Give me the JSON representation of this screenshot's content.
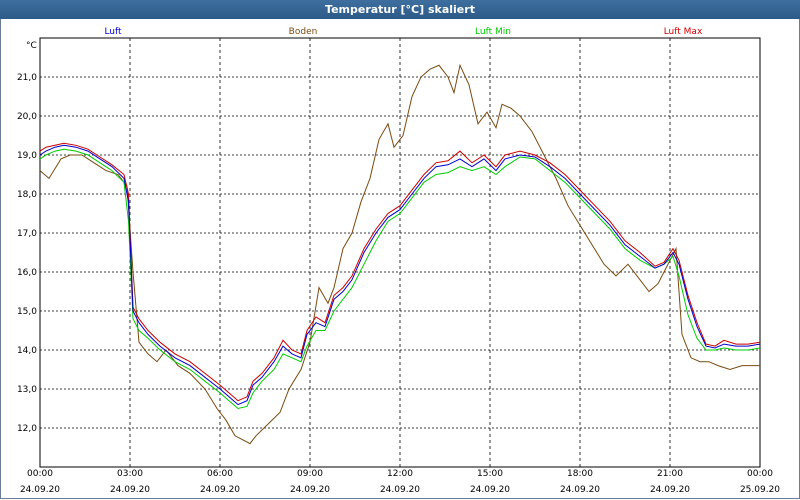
{
  "window": {
    "title": "Temperatur [°C] skaliert"
  },
  "chart_data": {
    "type": "line",
    "ylabel": "°C",
    "ylim": [
      11.0,
      22.0
    ],
    "yticks": [
      "12,0",
      "13,0",
      "14,0",
      "15,0",
      "16,0",
      "17,0",
      "18,0",
      "19,0",
      "20,0",
      "21,0"
    ],
    "xrange_hours": [
      0,
      24
    ],
    "xticks": [
      {
        "time": "00:00",
        "date": "24.09.20"
      },
      {
        "time": "03:00",
        "date": "24.09.20"
      },
      {
        "time": "06:00",
        "date": "24.09.20"
      },
      {
        "time": "09:00",
        "date": "24.09.20"
      },
      {
        "time": "12:00",
        "date": "24.09.20"
      },
      {
        "time": "15:00",
        "date": "24.09.20"
      },
      {
        "time": "18:00",
        "date": "24.09.20"
      },
      {
        "time": "21:00",
        "date": "24.09.20"
      },
      {
        "time": "00:00",
        "date": "25.09.20"
      }
    ],
    "grid": true,
    "legend_position": "top",
    "series": [
      {
        "name": "Luft",
        "color": "#0000cc",
        "x": [
          0,
          0.2,
          0.5,
          0.8,
          1.2,
          1.6,
          2.0,
          2.4,
          2.8,
          2.95,
          3.1,
          3.3,
          3.6,
          4.0,
          4.5,
          5.0,
          5.5,
          6.0,
          6.3,
          6.6,
          6.9,
          7.1,
          7.4,
          7.8,
          8.1,
          8.4,
          8.7,
          8.9,
          9.2,
          9.5,
          9.8,
          10.1,
          10.4,
          10.8,
          11.2,
          11.6,
          12.0,
          12.4,
          12.8,
          13.2,
          13.6,
          14.0,
          14.4,
          14.8,
          15.2,
          15.5,
          16.0,
          16.5,
          17.0,
          17.5,
          18.0,
          18.5,
          19.0,
          19.5,
          20.0,
          20.5,
          20.8,
          21.1,
          21.3,
          21.6,
          21.9,
          22.2,
          22.5,
          22.8,
          23.2,
          23.6,
          24.0
        ],
        "values": [
          19.0,
          19.1,
          19.2,
          19.25,
          19.2,
          19.1,
          18.9,
          18.7,
          18.4,
          17.8,
          15.0,
          14.7,
          14.4,
          14.1,
          13.8,
          13.6,
          13.3,
          13.0,
          12.8,
          12.6,
          12.7,
          13.1,
          13.3,
          13.7,
          14.1,
          13.9,
          13.8,
          14.4,
          14.7,
          14.6,
          15.3,
          15.5,
          15.8,
          16.5,
          17.0,
          17.4,
          17.6,
          18.0,
          18.4,
          18.7,
          18.75,
          18.9,
          18.7,
          18.9,
          18.6,
          18.9,
          19.0,
          18.95,
          18.7,
          18.4,
          18.0,
          17.6,
          17.2,
          16.7,
          16.4,
          16.1,
          16.2,
          16.5,
          16.2,
          15.3,
          14.6,
          14.1,
          14.05,
          14.15,
          14.1,
          14.1,
          14.15
        ]
      },
      {
        "name": "Boden",
        "color": "#7a4a10",
        "x": [
          0,
          0.3,
          0.7,
          1.0,
          1.4,
          1.8,
          2.2,
          2.6,
          2.9,
          3.1,
          3.3,
          3.6,
          3.9,
          4.2,
          4.6,
          5.0,
          5.5,
          5.9,
          6.2,
          6.5,
          7.0,
          7.2,
          7.6,
          8.0,
          8.3,
          8.7,
          9.0,
          9.3,
          9.6,
          9.8,
          10.1,
          10.4,
          10.7,
          11.0,
          11.3,
          11.6,
          11.8,
          12.1,
          12.4,
          12.7,
          13.0,
          13.3,
          13.6,
          13.8,
          14.0,
          14.3,
          14.6,
          14.9,
          15.2,
          15.4,
          15.7,
          16.0,
          16.4,
          16.8,
          17.2,
          17.6,
          18.0,
          18.4,
          18.8,
          19.2,
          19.6,
          20.0,
          20.3,
          20.6,
          20.8,
          21.0,
          21.2,
          21.4,
          21.7,
          22.0,
          22.3,
          22.6,
          23.0,
          23.4,
          23.8,
          24.0
        ],
        "values": [
          18.6,
          18.4,
          18.9,
          19.0,
          19.0,
          18.8,
          18.6,
          18.5,
          18.2,
          16.0,
          14.2,
          13.9,
          13.7,
          14.0,
          13.6,
          13.4,
          13.0,
          12.5,
          12.2,
          11.8,
          11.6,
          11.8,
          12.1,
          12.4,
          13.0,
          13.5,
          14.2,
          15.6,
          15.2,
          15.6,
          16.6,
          17.0,
          17.8,
          18.4,
          19.4,
          19.8,
          19.2,
          19.5,
          20.5,
          21.0,
          21.2,
          21.3,
          21.0,
          20.6,
          21.3,
          20.8,
          19.8,
          20.1,
          19.7,
          20.3,
          20.2,
          20.0,
          19.6,
          19.0,
          18.4,
          17.7,
          17.2,
          16.7,
          16.2,
          15.9,
          16.2,
          15.8,
          15.5,
          15.7,
          16.0,
          16.3,
          16.6,
          14.4,
          13.8,
          13.7,
          13.7,
          13.6,
          13.5,
          13.6,
          13.6,
          13.6
        ]
      },
      {
        "name": "Luft Min",
        "color": "#00cc00",
        "x": [
          0,
          0.2,
          0.5,
          0.8,
          1.2,
          1.6,
          2.0,
          2.4,
          2.8,
          2.95,
          3.1,
          3.3,
          3.6,
          4.0,
          4.5,
          5.0,
          5.5,
          6.0,
          6.3,
          6.6,
          6.9,
          7.1,
          7.4,
          7.8,
          8.1,
          8.4,
          8.7,
          8.9,
          9.2,
          9.5,
          9.8,
          10.1,
          10.4,
          10.8,
          11.2,
          11.6,
          12.0,
          12.4,
          12.8,
          13.2,
          13.6,
          14.0,
          14.4,
          14.8,
          15.2,
          15.5,
          16.0,
          16.5,
          17.0,
          17.5,
          18.0,
          18.5,
          19.0,
          19.5,
          20.0,
          20.5,
          20.8,
          21.1,
          21.3,
          21.6,
          21.9,
          22.2,
          22.5,
          22.8,
          23.2,
          23.6,
          24.0
        ],
        "values": [
          18.9,
          19.0,
          19.1,
          19.15,
          19.1,
          19.0,
          18.8,
          18.6,
          18.3,
          17.3,
          14.8,
          14.5,
          14.3,
          14.0,
          13.7,
          13.5,
          13.2,
          12.9,
          12.7,
          12.5,
          12.55,
          12.9,
          13.2,
          13.5,
          13.9,
          13.8,
          13.7,
          14.1,
          14.5,
          14.5,
          15.0,
          15.3,
          15.6,
          16.2,
          16.8,
          17.3,
          17.5,
          17.9,
          18.3,
          18.5,
          18.55,
          18.7,
          18.6,
          18.7,
          18.5,
          18.7,
          18.95,
          18.9,
          18.6,
          18.3,
          17.9,
          17.5,
          17.1,
          16.6,
          16.3,
          16.1,
          16.2,
          16.4,
          15.9,
          14.9,
          14.3,
          14.0,
          14.0,
          14.05,
          14.0,
          14.0,
          14.05
        ]
      },
      {
        "name": "Luft Max",
        "color": "#cc0000",
        "x": [
          0,
          0.2,
          0.5,
          0.8,
          1.2,
          1.6,
          2.0,
          2.4,
          2.8,
          2.95,
          3.1,
          3.3,
          3.6,
          4.0,
          4.5,
          5.0,
          5.5,
          6.0,
          6.3,
          6.6,
          6.9,
          7.1,
          7.4,
          7.8,
          8.1,
          8.4,
          8.7,
          8.9,
          9.2,
          9.5,
          9.8,
          10.1,
          10.4,
          10.8,
          11.2,
          11.6,
          12.0,
          12.4,
          12.8,
          13.2,
          13.6,
          14.0,
          14.4,
          14.8,
          15.2,
          15.5,
          16.0,
          16.5,
          17.0,
          17.5,
          18.0,
          18.5,
          19.0,
          19.5,
          20.0,
          20.5,
          20.8,
          21.1,
          21.3,
          21.6,
          21.9,
          22.2,
          22.5,
          22.8,
          23.2,
          23.6,
          24.0
        ],
        "values": [
          19.1,
          19.2,
          19.25,
          19.3,
          19.25,
          19.15,
          18.95,
          18.75,
          18.5,
          18.0,
          15.1,
          14.8,
          14.5,
          14.2,
          13.9,
          13.7,
          13.4,
          13.1,
          12.9,
          12.7,
          12.8,
          13.2,
          13.4,
          13.8,
          14.25,
          14.0,
          13.9,
          14.5,
          14.85,
          14.7,
          15.4,
          15.6,
          15.9,
          16.6,
          17.1,
          17.5,
          17.7,
          18.1,
          18.5,
          18.8,
          18.85,
          19.1,
          18.8,
          19.0,
          18.7,
          19.0,
          19.1,
          19.0,
          18.8,
          18.5,
          18.1,
          17.7,
          17.3,
          16.8,
          16.5,
          16.15,
          16.25,
          16.6,
          16.3,
          15.4,
          14.7,
          14.15,
          14.1,
          14.25,
          14.15,
          14.15,
          14.2
        ]
      }
    ]
  }
}
